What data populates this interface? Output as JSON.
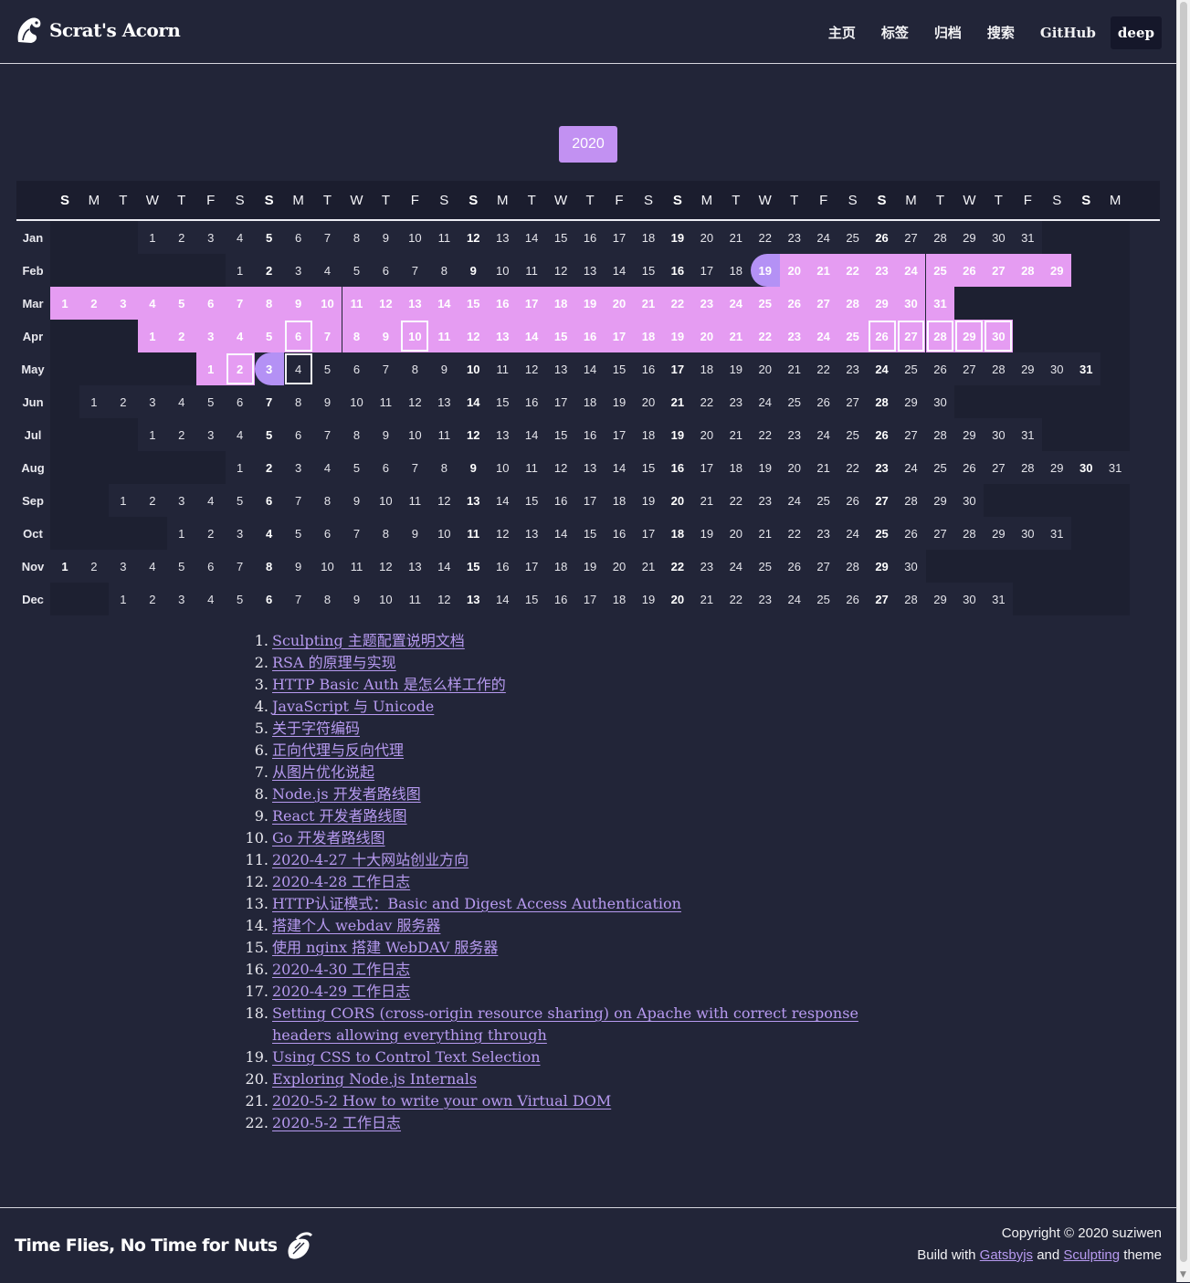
{
  "header": {
    "brand": "Scrat's Acorn",
    "nav": [
      "主页",
      "标签",
      "归档",
      "搜索",
      "GitHub"
    ],
    "theme_button": "deep"
  },
  "calendar": {
    "year": "2020",
    "weekday_header": [
      "S",
      "M",
      "T",
      "W",
      "T",
      "F",
      "S",
      "S",
      "M",
      "T",
      "W",
      "T",
      "F",
      "S",
      "S",
      "M",
      "T",
      "W",
      "T",
      "F",
      "S",
      "S",
      "M",
      "T",
      "W",
      "T",
      "F",
      "S",
      "S",
      "M",
      "T",
      "W",
      "T",
      "F",
      "S",
      "S",
      "M"
    ],
    "months": [
      {
        "label": "Jan",
        "start": 4,
        "days": 31
      },
      {
        "label": "Feb",
        "start": 7,
        "days": 29
      },
      {
        "label": "Mar",
        "start": 1,
        "days": 31
      },
      {
        "label": "Apr",
        "start": 4,
        "days": 30
      },
      {
        "label": "May",
        "start": 6,
        "days": 31
      },
      {
        "label": "Jun",
        "start": 2,
        "days": 30
      },
      {
        "label": "Jul",
        "start": 4,
        "days": 31
      },
      {
        "label": "Aug",
        "start": 7,
        "days": 31
      },
      {
        "label": "Sep",
        "start": 3,
        "days": 30
      },
      {
        "label": "Oct",
        "start": 5,
        "days": 31
      },
      {
        "label": "Nov",
        "start": 1,
        "days": 30
      },
      {
        "label": "Dec",
        "start": 3,
        "days": 31
      }
    ],
    "colors": {
      "post": "#e59cf2",
      "range_start": "#b491f5",
      "year": "#c291f2"
    },
    "highlights": [
      {
        "month": "Feb",
        "from": 19,
        "to": 29,
        "range_start": 19
      },
      {
        "month": "Mar",
        "from": 1,
        "to": 31
      },
      {
        "month": "Apr",
        "from": 1,
        "to": 30,
        "boxed": [
          6,
          10,
          26,
          27,
          28,
          29,
          30
        ]
      },
      {
        "month": "May",
        "from": 1,
        "to": 3,
        "range_start": 3,
        "boxed": [
          2
        ]
      }
    ],
    "boxed_plain": [
      {
        "month": "May",
        "day": 4
      }
    ]
  },
  "posts": [
    "Sculpting 主题配置说明文档",
    "RSA 的原理与实现",
    "HTTP Basic Auth 是怎么样工作的",
    "JavaScript 与 Unicode",
    "关于字符编码",
    "正向代理与反向代理",
    "从图片优化说起",
    "Node.js 开发者路线图",
    "React 开发者路线图",
    "Go 开发者路线图",
    "2020-4-27 十大网站创业方向",
    "2020-4-28 工作日志",
    "HTTP认证模式：Basic and Digest Access Authentication",
    "搭建个人 webdav 服务器",
    "使用 nginx 搭建 WebDAV 服务器",
    "2020-4-30 工作日志",
    "2020-4-29 工作日志",
    "Setting CORS (cross-origin resource sharing) on Apache with correct response headers allowing everything through",
    "Using CSS to Control Text Selection",
    "Exploring Node.js Internals",
    "2020-5-2 How to write your own Virtual DOM",
    "2020-5-2 工作日志"
  ],
  "footer": {
    "slogan": "Time Flies, No Time for Nuts",
    "copyright": "Copyright © 2020 suziwen",
    "build_prefix": "Build with",
    "build_link1": "Gatsbyjs",
    "build_and": "and",
    "build_link2": "Sculpting",
    "build_suffix": "theme"
  }
}
